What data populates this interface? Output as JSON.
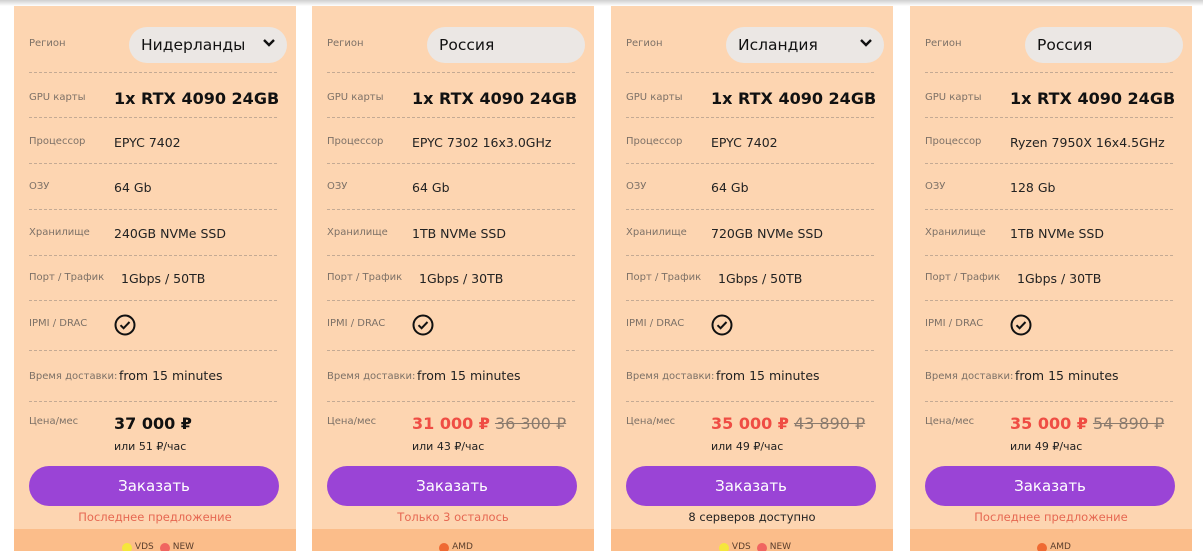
{
  "labels": {
    "region": "Регион",
    "gpu": "GPU карты",
    "cpu": "Процессор",
    "ram": "ОЗУ",
    "storage": "Хранилище",
    "port": "Порт / Трафик",
    "ipmi": "IPMI / DRAC",
    "delivery": "Время доставки:",
    "price": "Цена/мес",
    "order": "Заказать"
  },
  "colors": {
    "card": "#fdd5b1",
    "accent": "#9a44d6",
    "price_red": "#ef4d44",
    "status_red": "#e66852"
  },
  "cards": [
    {
      "region": "Нидерланды",
      "region_dropdown": true,
      "gpu": "1x RTX 4090 24GB",
      "cpu": "EPYC 7402",
      "ram": "64 Gb",
      "storage": "240GB NVMe SSD",
      "port": "1Gbps / 50TB",
      "ipmi": "check-circle-icon",
      "delivery": "from 15 minutes",
      "price": "37 000 ₽",
      "price_old": "",
      "hourly": "или 51 ₽/час",
      "status": "Последнее предложение",
      "tags": [
        {
          "label": "VDS",
          "color": "#f5e63c"
        },
        {
          "label": "NEW",
          "color": "#f06560"
        }
      ]
    },
    {
      "region": "Россия",
      "region_dropdown": false,
      "gpu": "1x RTX 4090 24GB",
      "cpu": "EPYC 7302 16x3.0GHz",
      "ram": "64 Gb",
      "storage": "1TB NVMe SSD",
      "port": "1Gbps / 30TB",
      "ipmi": "check-circle-icon",
      "delivery": "from 15 minutes",
      "price": "31 000 ₽",
      "price_old": "36 300 ₽",
      "hourly": "или 43 ₽/час",
      "status": "Только 3 осталось",
      "tags": [
        {
          "label": "AMD",
          "color": "#ef6a33"
        }
      ]
    },
    {
      "region": "Исландия",
      "region_dropdown": true,
      "gpu": "1x RTX 4090 24GB",
      "cpu": "EPYC 7402",
      "ram": "64 Gb",
      "storage": "720GB NVMe SSD",
      "port": "1Gbps / 50TB",
      "ipmi": "check-circle-icon",
      "delivery": "from 15 minutes",
      "price": "35 000 ₽",
      "price_old": "43 890 ₽",
      "hourly": "или 49 ₽/час",
      "status": "8 серверов доступно",
      "tags": [
        {
          "label": "VDS",
          "color": "#f5e63c"
        },
        {
          "label": "NEW",
          "color": "#f06560"
        }
      ]
    },
    {
      "region": "Россия",
      "region_dropdown": false,
      "gpu": "1x RTX 4090 24GB",
      "cpu": "Ryzen 7950X 16x4.5GHz",
      "ram": "128 Gb",
      "storage": "1TB NVMe SSD",
      "port": "1Gbps / 30TB",
      "ipmi": "check-circle-icon",
      "delivery": "from 15 minutes",
      "price": "35 000 ₽",
      "price_old": "54 890 ₽",
      "hourly": "или 49 ₽/час",
      "status": "Последнее предложение",
      "tags": [
        {
          "label": "AMD",
          "color": "#ef6a33"
        }
      ]
    }
  ]
}
